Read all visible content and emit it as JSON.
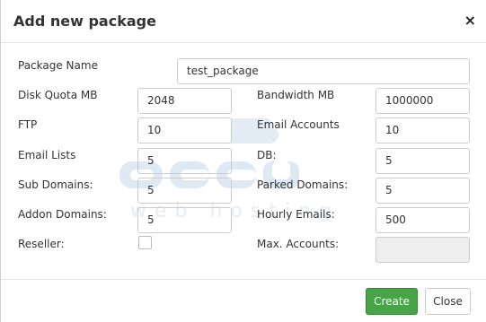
{
  "dialog": {
    "title": "Add new package",
    "close_icon": "×"
  },
  "form": {
    "package_name": {
      "label": "Package Name",
      "value": "test_package"
    },
    "disk_quota": {
      "label": "Disk Quota MB",
      "value": "2048"
    },
    "bandwidth": {
      "label": "Bandwidth MB",
      "value": "1000000"
    },
    "ftp": {
      "label": "FTP",
      "value": "10"
    },
    "email_accounts": {
      "label": "Email Accounts",
      "value": "10"
    },
    "email_lists": {
      "label": "Email Lists",
      "value": "5"
    },
    "db": {
      "label": "DB:",
      "value": "5"
    },
    "sub_domains": {
      "label": "Sub Domains:",
      "value": "5"
    },
    "parked_domains": {
      "label": "Parked Domains:",
      "value": "5"
    },
    "addon_domains": {
      "label": "Addon Domains:",
      "value": "5"
    },
    "hourly_emails": {
      "label": "Hourly Emails:",
      "value": "500"
    },
    "reseller": {
      "label": "Reseller:",
      "checked": false
    },
    "max_accounts": {
      "label": "Max. Accounts:",
      "value": ""
    }
  },
  "footer": {
    "create_label": "Create",
    "close_label": "Close"
  },
  "colors": {
    "create_button": "#47a447",
    "watermark": "#dde8f2"
  }
}
